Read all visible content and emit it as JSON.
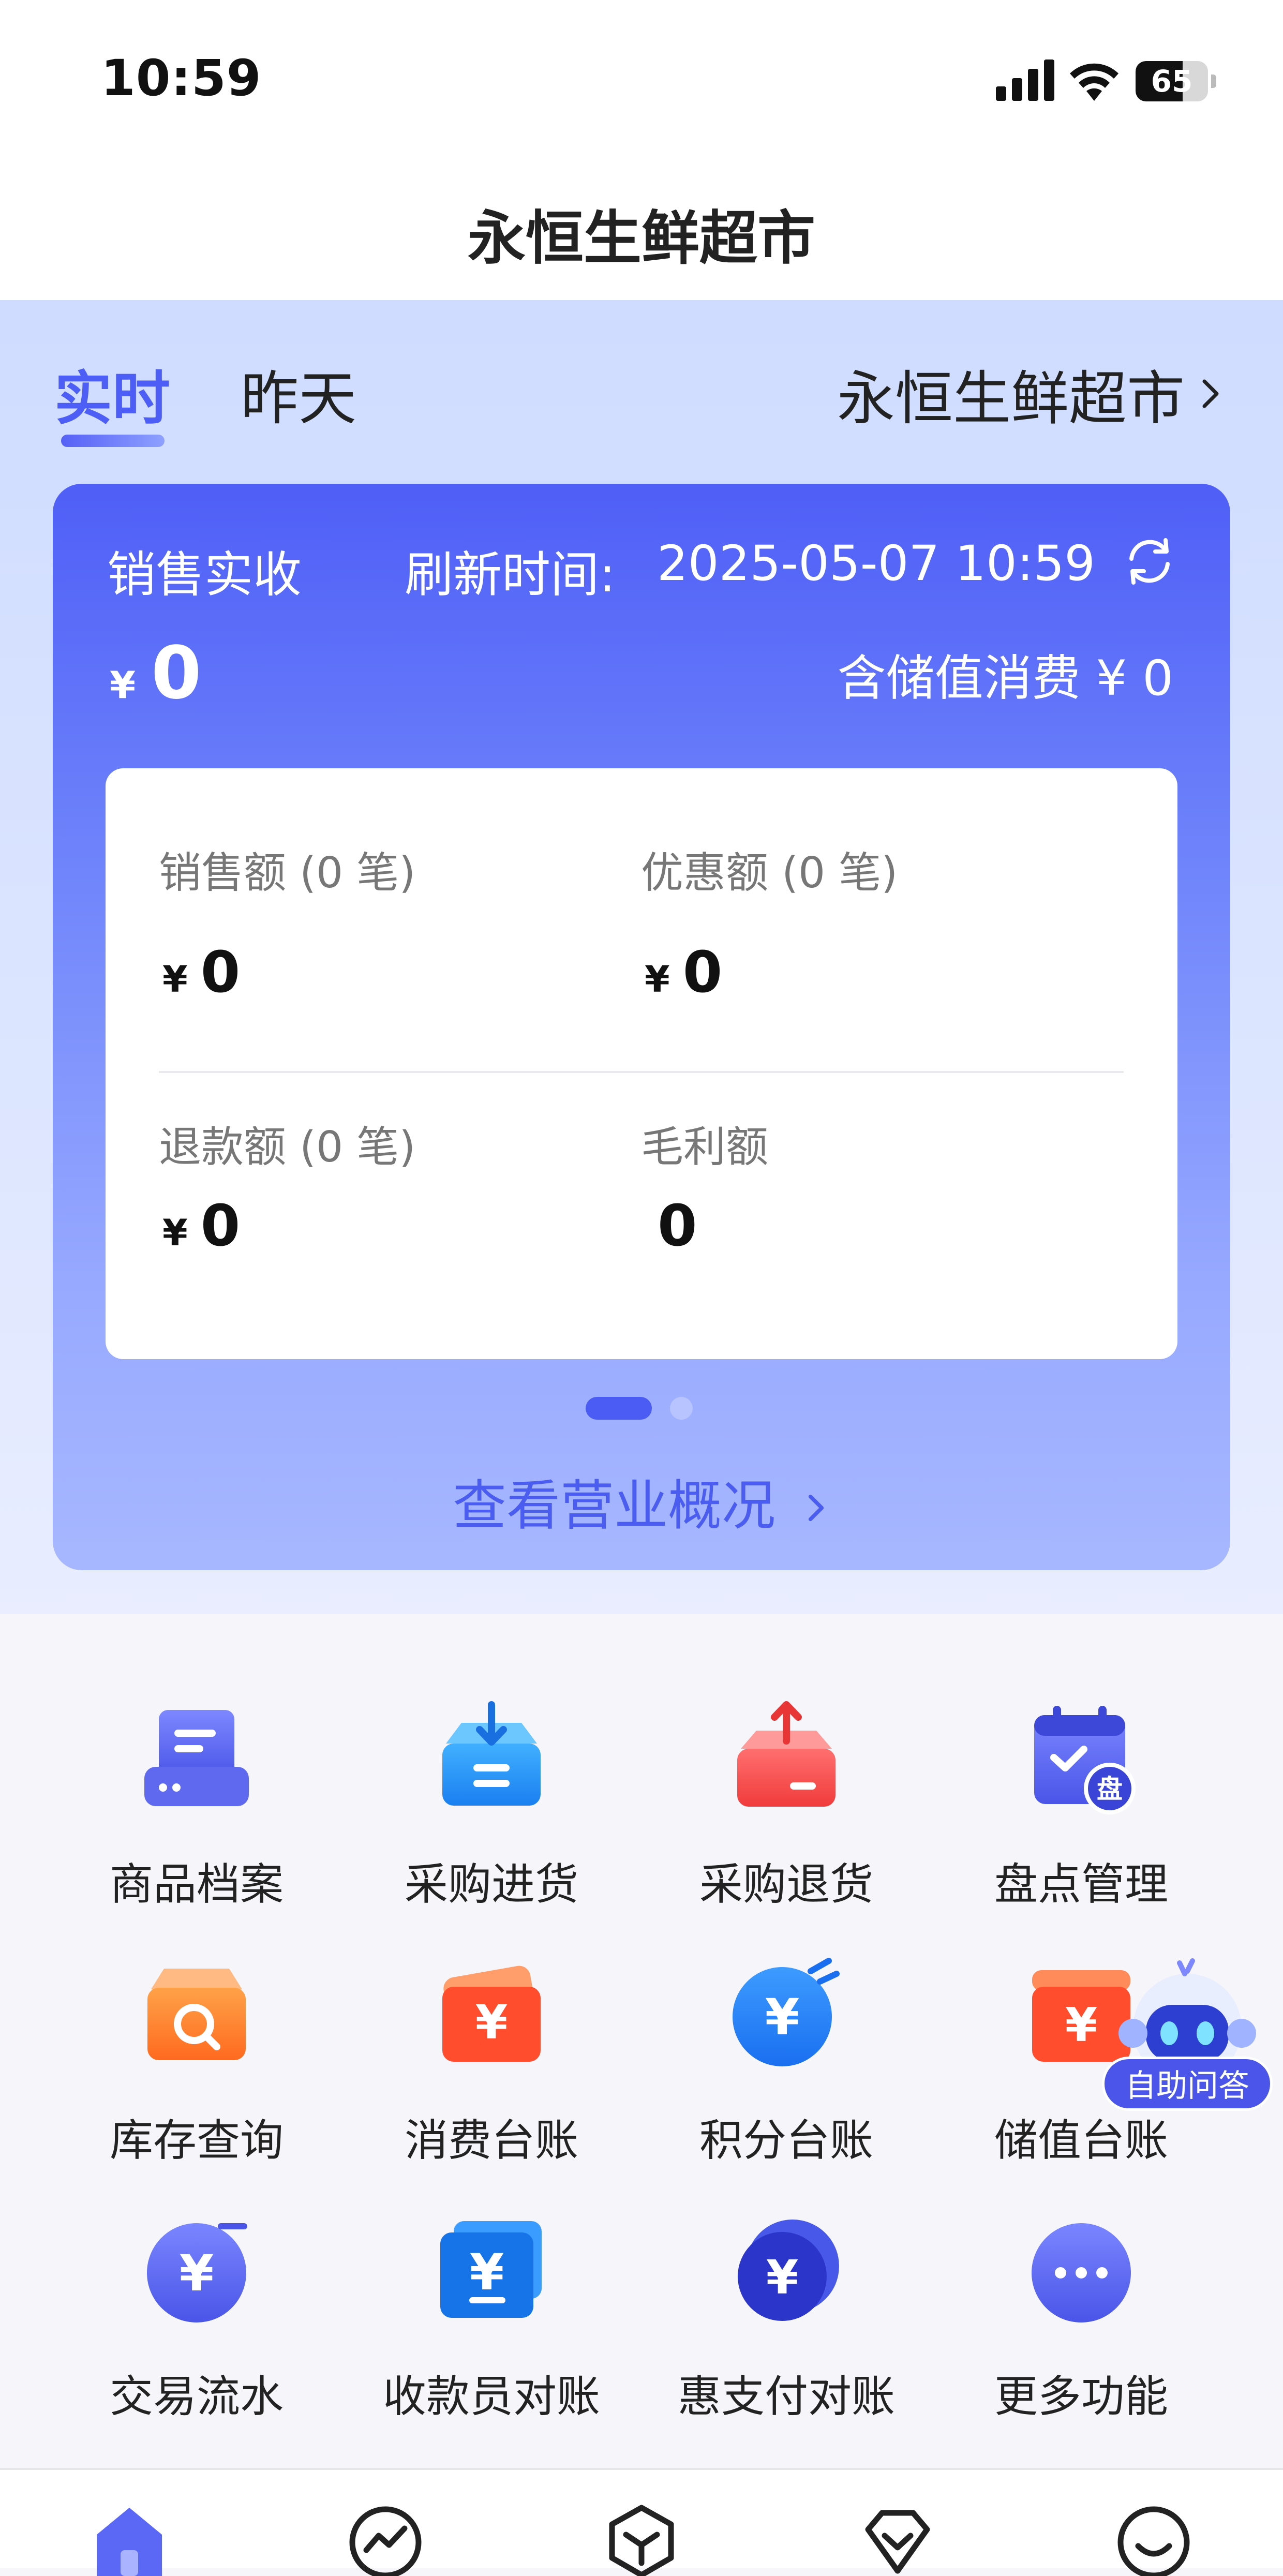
{
  "status_bar": {
    "time": "10:59",
    "battery": "65",
    "battery_level": 0.65
  },
  "nav": {
    "title": "永恒生鲜超市"
  },
  "tabs": {
    "realtime": "实时",
    "yesterday": "昨天"
  },
  "store_selector": {
    "label": "永恒生鲜超市"
  },
  "summary": {
    "label": "销售实收",
    "refresh_label": "刷新时间:",
    "refresh_time": "2025-05-07 10:59",
    "currency": "¥",
    "amount": "0",
    "stored_value_text": "含储值消费 ¥ 0"
  },
  "stats": [
    {
      "label": "销售额 (0 笔)",
      "currency": "¥",
      "value": "0"
    },
    {
      "label": "优惠额 (0 笔)",
      "currency": "¥",
      "value": "0"
    },
    {
      "label": "退款额 (0 笔)",
      "currency": "¥",
      "value": "0"
    },
    {
      "label": "毛利额",
      "currency": "",
      "value": "0"
    }
  ],
  "overview_link": {
    "label": "查看营业概况"
  },
  "functions": [
    {
      "label": "商品档案",
      "icon": "product-archive-icon"
    },
    {
      "label": "采购进货",
      "icon": "purchase-in-icon"
    },
    {
      "label": "采购退货",
      "icon": "purchase-return-icon"
    },
    {
      "label": "盘点管理",
      "icon": "inventory-count-icon",
      "badge": "盘"
    },
    {
      "label": "库存查询",
      "icon": "stock-search-icon"
    },
    {
      "label": "消费台账",
      "icon": "consumption-ledger-icon",
      "badge": "¥"
    },
    {
      "label": "积分台账",
      "icon": "points-ledger-icon",
      "badge": "¥"
    },
    {
      "label": "储值台账",
      "icon": "stored-value-ledger-icon",
      "badge": "¥"
    },
    {
      "label": "交易流水",
      "icon": "transactions-icon",
      "badge": "¥"
    },
    {
      "label": "收款员对账",
      "icon": "cashier-reconcile-icon",
      "badge": "¥"
    },
    {
      "label": "惠支付对账",
      "icon": "pay-reconcile-icon",
      "badge": "¥"
    },
    {
      "label": "更多功能",
      "icon": "more-icon"
    }
  ],
  "helper": {
    "label": "自助问答"
  },
  "colors": {
    "accent": "#4c5ef5",
    "card_top": "#4f5ff7",
    "card_bottom": "#a7b7ff"
  }
}
